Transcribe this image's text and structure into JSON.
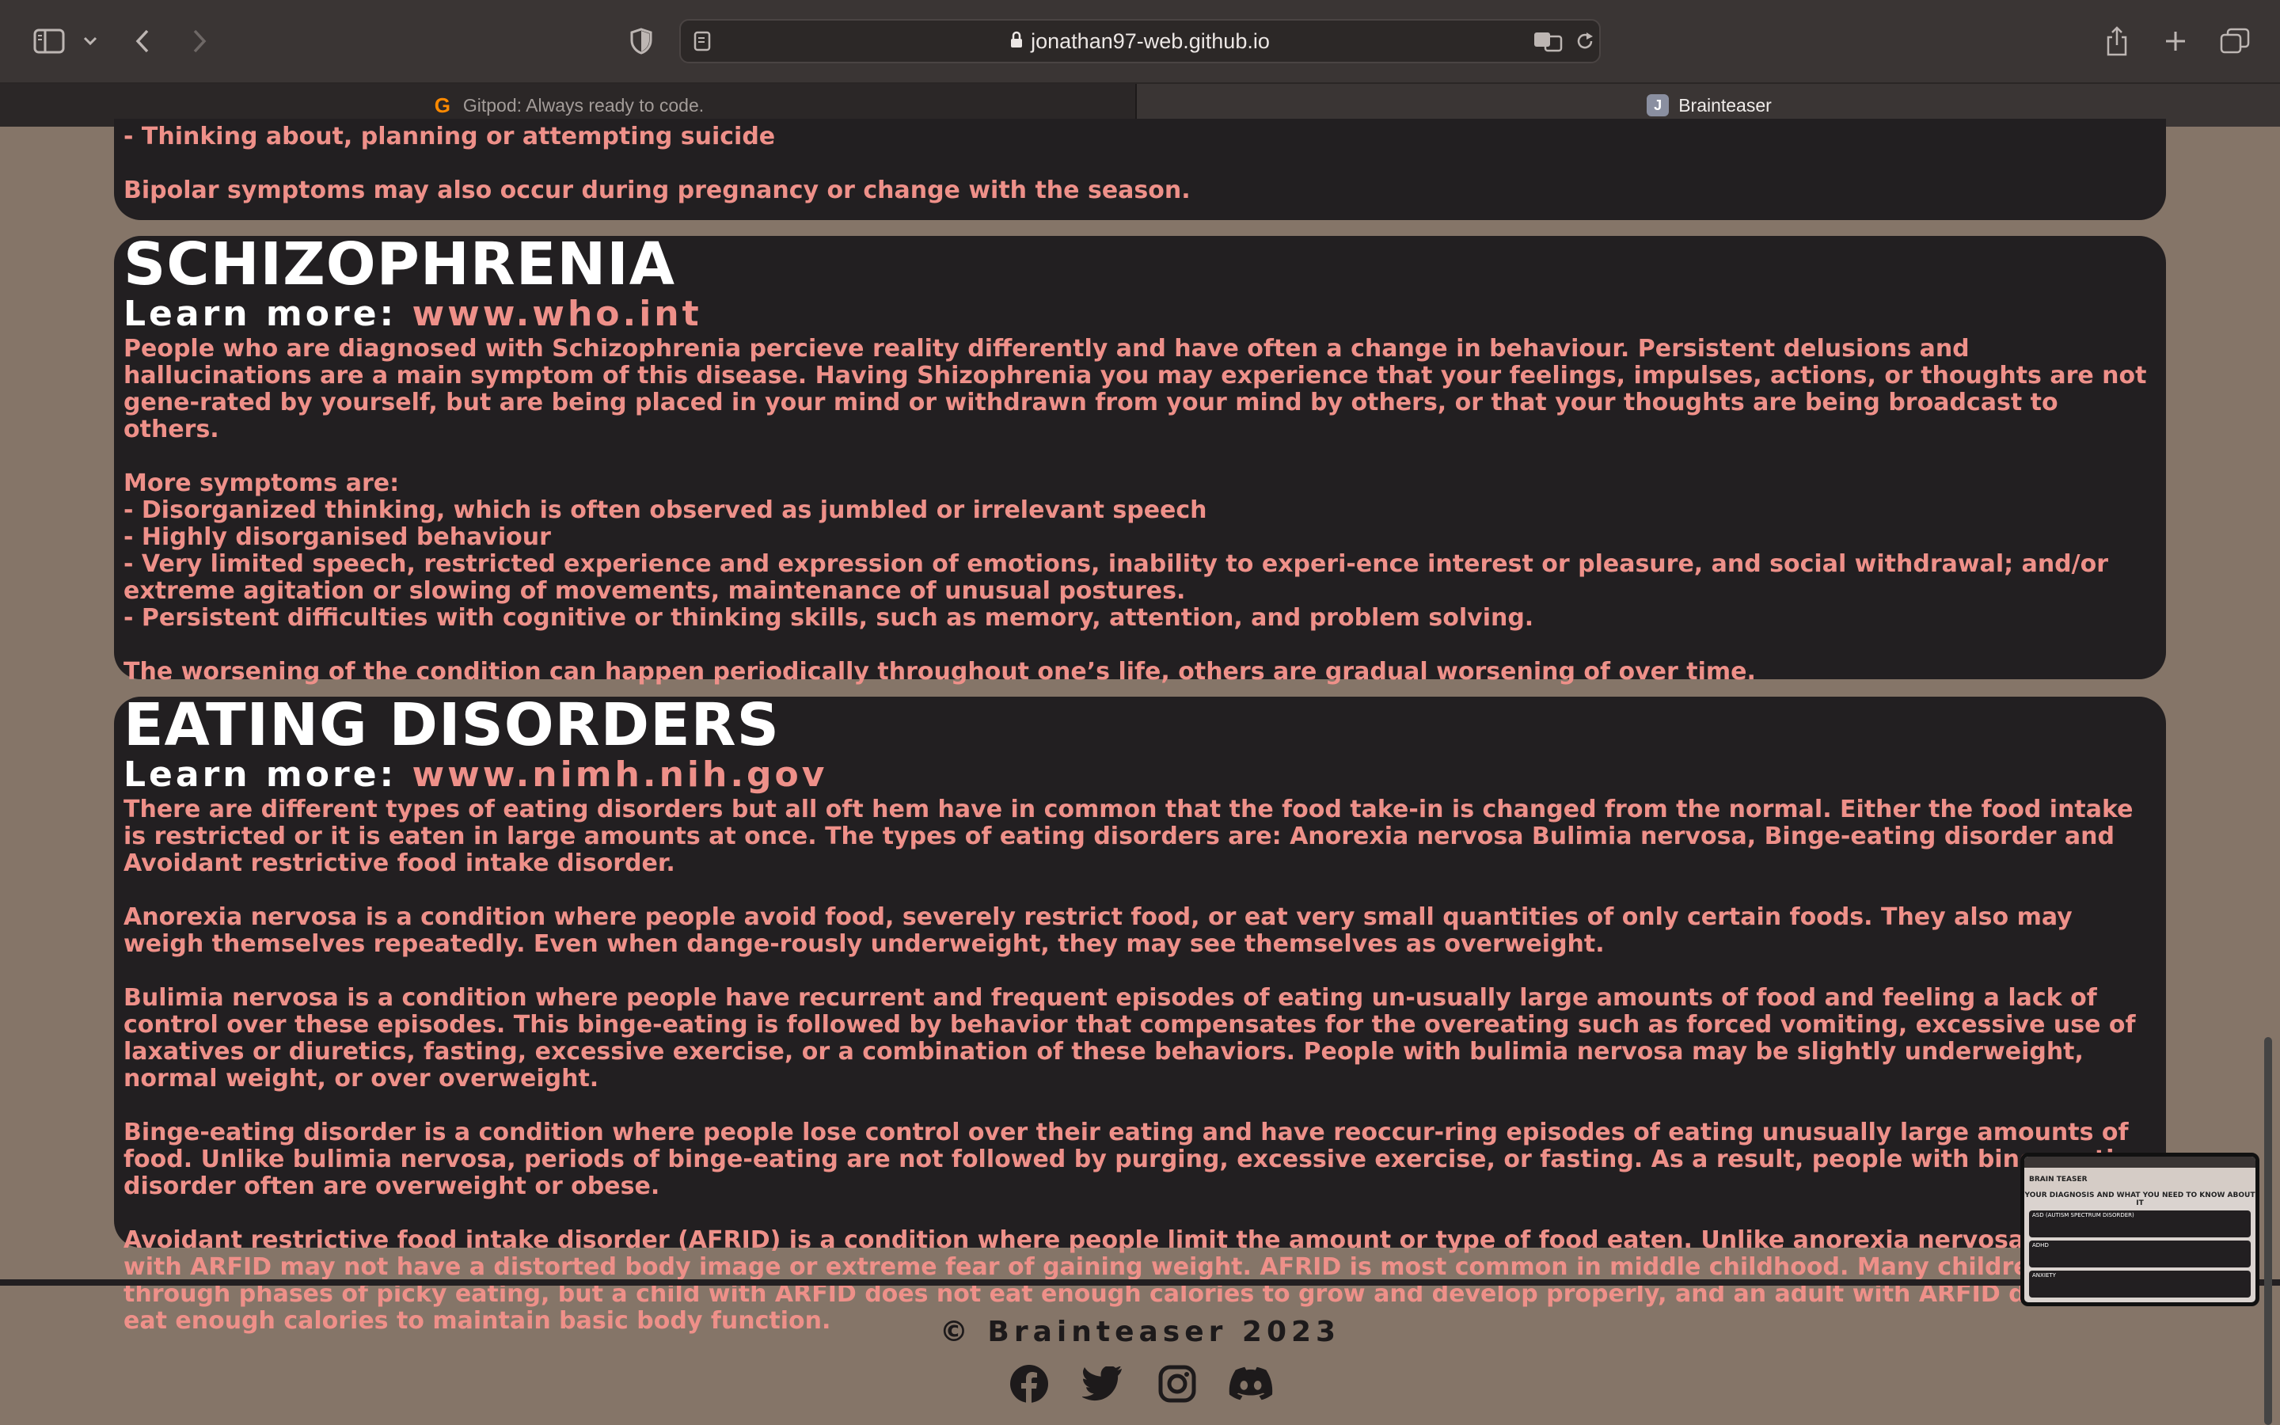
{
  "browser": {
    "url": "jonathan97-web.github.io",
    "tabs": [
      {
        "label": "Gitpod: Always ready to code.",
        "favicon": "G",
        "active": false
      },
      {
        "label": "Brainteaser",
        "favicon": "J",
        "active": true
      }
    ]
  },
  "sections": {
    "prev": {
      "lines": [
        "- Thinking about, planning or attempting suicide",
        "",
        "Bipolar symptoms may also occur during pregnancy or change with the season."
      ]
    },
    "schizophrenia": {
      "title": "SCHIZOPHRENIA",
      "learn_more_label": "Learn more: ",
      "learn_more_link": "www.who.int",
      "paragraphs": [
        "People who are diagnosed with Schizophrenia percieve reality differently and have often a change in behaviour. Persistent delusions and hallucinations are a main symptom of this disease. Having Shizophrenia you may experience that your feelings, impulses, actions, or thoughts are not gene-rated by yourself, but are being placed in your mind or withdrawn from your mind by others, or that your thoughts are being broadcast to others.",
        "",
        "More symptoms are:",
        "- Disorganized thinking, which is often observed as jumbled or irrelevant speech",
        "- Highly disorganised behaviour",
        "- Very limited speech, restricted experience and expression of emotions, inability to experi-ence interest or pleasure, and social withdrawal; and/or extreme agitation or slowing of movements, maintenance of unusual postures.",
        "- Persistent difficulties with cognitive or thinking skills, such as memory, attention, and problem solving.",
        "",
        "The worsening of the condition can happen periodically throughout one’s life, others are gradual worsening of over time."
      ]
    },
    "eating": {
      "title": "EATING DISORDERS",
      "learn_more_label": "Learn more: ",
      "learn_more_link": "www.nimh.nih.gov",
      "paragraphs": [
        "There are different types of eating disorders but all oft hem have in common that the food take-in is changed from the normal. Either the food intake is restricted or it is eaten in large amounts at once. The types of eating disorders are: Anorexia nervosa Bulimia nervosa, Binge-eating disorder and Avoidant restrictive food intake disorder.",
        "",
        "Anorexia nervosa is a condition where people avoid food, severely restrict food, or eat very small quantities of only certain foods. They also may weigh themselves repeatedly. Even when dange-rously underweight, they may see themselves as overweight.",
        "",
        "Bulimia nervosa is a condition where people have recurrent and frequent episodes of eating un-usually large amounts of food and feeling a lack of control over these episodes. This binge-eating is followed by behavior that compensates for the overeating such as forced vomiting, excessive use of laxatives or diuretics, fasting, excessive exercise, or a combination of these behaviors. People with bulimia nervosa may be slightly underweight, normal weight, or over overweight.",
        "",
        "Binge-eating disorder is a condition where people lose control over their eating and have reoccur-ring episodes of eating unusually large amounts of food. Unlike bulimia nervosa, periods of binge-eating are not followed by purging, excessive exercise, or fasting. As a result, people with binge-eating disorder often are overweight or obese.",
        "",
        "Avoidant restrictive food intake disorder (AFRID) is a condition where people limit the amount or type of food eaten. Unlike anorexia nervosa, people with ARFID may not have a distorted body image or extreme fear of gaining weight. AFRID is most common in middle childhood. Many children go through phases of picky eating, but a child with ARFID does not eat enough calories to grow and develop properly, and an adult with ARFID does not eat enough calories to maintain basic body function."
      ]
    }
  },
  "footer": {
    "copyright": "© Brainteaser 2023",
    "social": [
      "facebook-icon",
      "twitter-icon",
      "instagram-icon",
      "discord-icon"
    ]
  },
  "thumbnail": {
    "brand": "BRAIN TEASER",
    "title": "YOUR DIAGNOSIS AND WHAT YOU NEED TO KNOW ABOUT IT",
    "sections": [
      "ASD (AUTISM SPECTRUM DISORDER)",
      "ADHD",
      "ANXIETY"
    ]
  },
  "colors": {
    "page_bg": "#857568",
    "card_bg": "#221f21",
    "text_accent": "#ee9089",
    "heading": "#ffffff"
  }
}
